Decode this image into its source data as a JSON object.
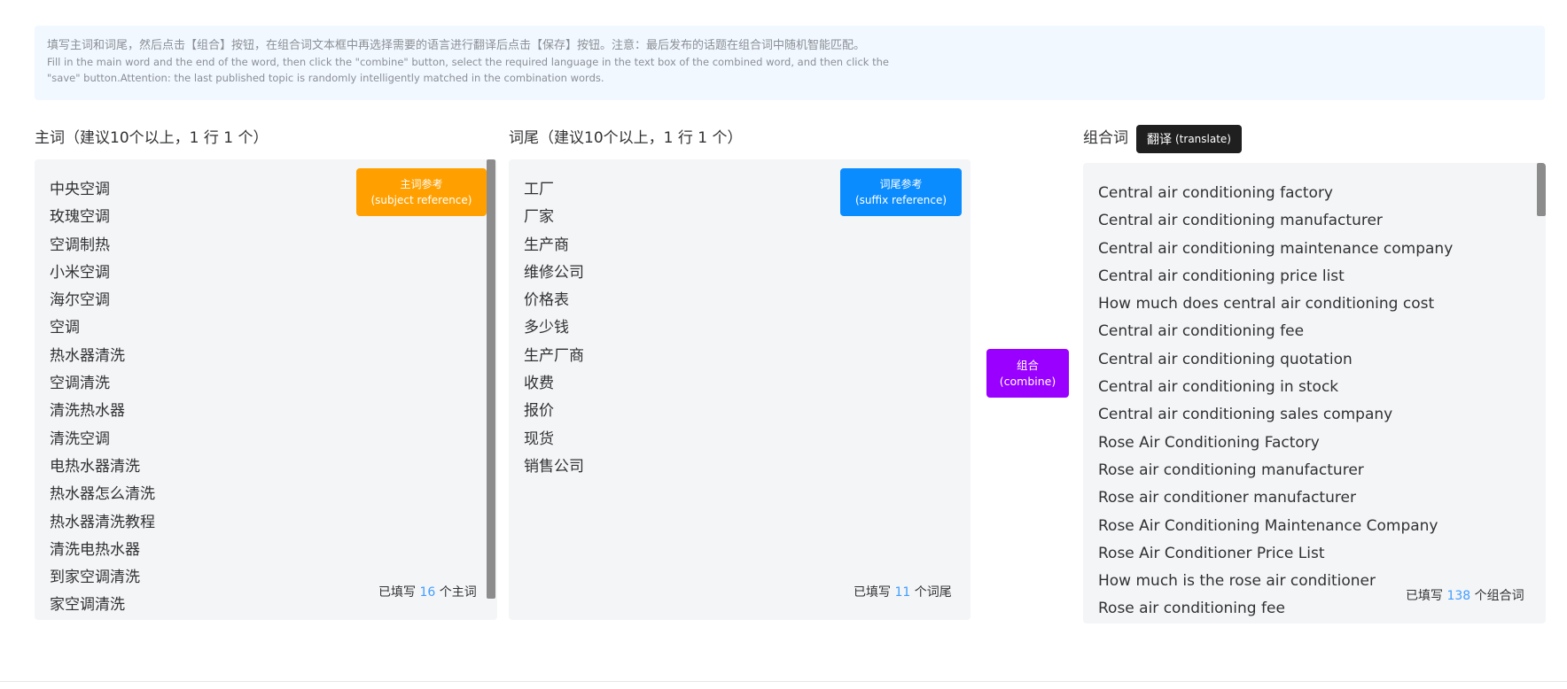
{
  "notice": {
    "zh": "填写主词和词尾，然后点击【组合】按钮，在组合词文本框中再选择需要的语言进行翻译后点击【保存】按钮。注意：最后发布的话题在组合词中随机智能匹配。",
    "en_line1": "Fill in the main word and the end of the word, then click the \"combine\" button, select the required language in the text box of the combined word, and then click the",
    "en_line2": "\"save\" button.Attention: the last published topic is randomly intelligently matched in the combination words."
  },
  "subject": {
    "title": "主词（建议10个以上，1 行 1 个）",
    "ref_button_zh": "主词参考",
    "ref_button_en": "(subject reference)",
    "items": [
      "中央空调",
      "玫瑰空调",
      "空调制热",
      "小米空调",
      "海尔空调",
      "空调",
      "热水器清洗",
      "空调清洗",
      "清洗热水器",
      "清洗空调",
      "电热水器清洗",
      "热水器怎么清洗",
      "热水器清洗教程",
      "清洗电热水器",
      "到家空调清洗",
      "家空调清洗"
    ],
    "count_prefix": "已填写",
    "count": "16",
    "count_suffix": "个主词"
  },
  "suffix": {
    "title": "词尾（建议10个以上，1 行 1 个）",
    "ref_button_zh": "词尾参考",
    "ref_button_en": "(suffix reference)",
    "items": [
      "工厂",
      "厂家",
      "生产商",
      "维修公司",
      "价格表",
      "多少钱",
      "生产厂商",
      "收费",
      "报价",
      "现货",
      "销售公司"
    ],
    "count_prefix": "已填写",
    "count": "11",
    "count_suffix": "个词尾"
  },
  "combine": {
    "label_zh": "组合",
    "label_en": "(combine)"
  },
  "combined": {
    "title": "组合词",
    "translate_zh": "翻译",
    "translate_en": "(translate)",
    "items": [
      "Central air conditioning factory",
      "Central air conditioning manufacturer",
      "Central air conditioning maintenance company",
      "Central air conditioning price list",
      "How much does central air conditioning cost",
      "Central air conditioning fee",
      "Central air conditioning quotation",
      "Central air conditioning in stock",
      "Central air conditioning sales company",
      "Rose Air Conditioning Factory",
      "Rose air conditioning manufacturer",
      "Rose air conditioner manufacturer",
      "Rose Air Conditioning Maintenance Company",
      "Rose Air Conditioner Price List",
      "How much is the rose air conditioner",
      "Rose air conditioning fee"
    ],
    "count_prefix": "已填写",
    "count": "138",
    "count_suffix": "个组合词"
  },
  "colors": {
    "subject_ref": "#ffa000",
    "suffix_ref": "#0a8cff",
    "combine": "#9900ff",
    "count_number": "#409eff"
  }
}
